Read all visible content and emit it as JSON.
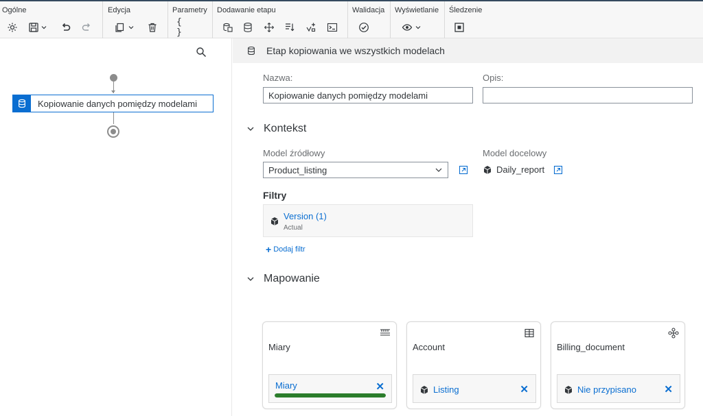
{
  "toolbar": {
    "groups": [
      {
        "label": "Ogólne"
      },
      {
        "label": "Edycja"
      },
      {
        "label": "Parametry"
      },
      {
        "label": "Dodawanie etapu"
      },
      {
        "label": "Walidacja"
      },
      {
        "label": "Wyświetlanie"
      },
      {
        "label": "Śledzenie"
      }
    ],
    "accent_color": "#0a6ed1"
  },
  "flow": {
    "node_label": "Kopiowanie danych pomiędzy modelami"
  },
  "panel": {
    "title": "Etap kopiowania we wszystkich modelach",
    "name_label": "Nazwa:",
    "name_value": "Kopiowanie danych pomiędzy modelami",
    "desc_label": "Opis:",
    "desc_value": "",
    "context": {
      "title": "Kontekst",
      "source_label": "Model źródłowy",
      "source_value": "Product_listing",
      "target_label": "Model docelowy",
      "target_value": "Daily_report"
    },
    "filters": {
      "title": "Filtry",
      "items": [
        {
          "name": "Version (1)",
          "value": "Actual"
        }
      ],
      "add_label": "Dodaj filtr"
    },
    "mapping": {
      "title": "Mapowanie",
      "cards": [
        {
          "title": "Miary",
          "chip": "Miary",
          "progress": 1.0
        },
        {
          "title": "Account",
          "chip": "Listing"
        },
        {
          "title": "Billing_document",
          "chip": "Nie przypisano"
        }
      ]
    }
  },
  "colors": {
    "progress": "#2b7d2b",
    "header_bg": "#f2f2f2"
  }
}
